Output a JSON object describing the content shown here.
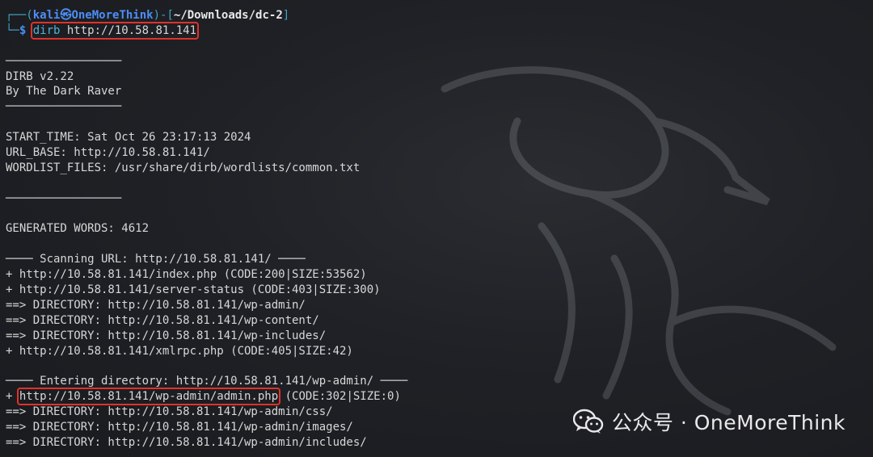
{
  "prompt": {
    "open_bracket": "┌──(",
    "user": "kali",
    "at": "㉿",
    "host": "OneMoreThink",
    "mid": ")-[",
    "cwd": "~/Downloads/dc-2",
    "close": "]",
    "prefix": "└─",
    "symbol": "$",
    "command_name": "dirb",
    "command_args": " http://10.58.81.141"
  },
  "lines": {
    "rule1": "─────────────────",
    "banner1": "DIRB v2.22",
    "banner2": "By The Dark Raver",
    "rule2": "─────────────────",
    "start_time": "START_TIME: Sat Oct 26 23:17:13 2024",
    "url_base": "URL_BASE: http://10.58.81.141/",
    "wordlist": "WORDLIST_FILES: /usr/share/dirb/wordlists/common.txt",
    "rule3": "─────────────────",
    "generated": "GENERATED WORDS: 4612",
    "scanning": "──── Scanning URL: http://10.58.81.141/ ────",
    "r1": "+ http://10.58.81.141/index.php (CODE:200|SIZE:53562)",
    "r2": "+ http://10.58.81.141/server-status (CODE:403|SIZE:300)",
    "r3": "==> DIRECTORY: http://10.58.81.141/wp-admin/",
    "r4": "==> DIRECTORY: http://10.58.81.141/wp-content/",
    "r5": "==> DIRECTORY: http://10.58.81.141/wp-includes/",
    "r6": "+ http://10.58.81.141/xmlrpc.php (CODE:405|SIZE:42)",
    "entering": "──── Entering directory: http://10.58.81.141/wp-admin/ ────",
    "r7_prefix": "+ ",
    "r7_url": "http://10.58.81.141/wp-admin/admin.php",
    "r7_suffix": " (CODE:302|SIZE:0)",
    "r8": "==> DIRECTORY: http://10.58.81.141/wp-admin/css/",
    "r9": "==> DIRECTORY: http://10.58.81.141/wp-admin/images/",
    "r10": "==> DIRECTORY: http://10.58.81.141/wp-admin/includes/"
  },
  "watermark": {
    "text": "公众号 · OneMoreThink",
    "icon": "wechat-icon"
  },
  "colors": {
    "highlight_box": "#e0322a",
    "prompt_blue": "#4c8ef5",
    "frame_teal": "#3ea5c2"
  }
}
